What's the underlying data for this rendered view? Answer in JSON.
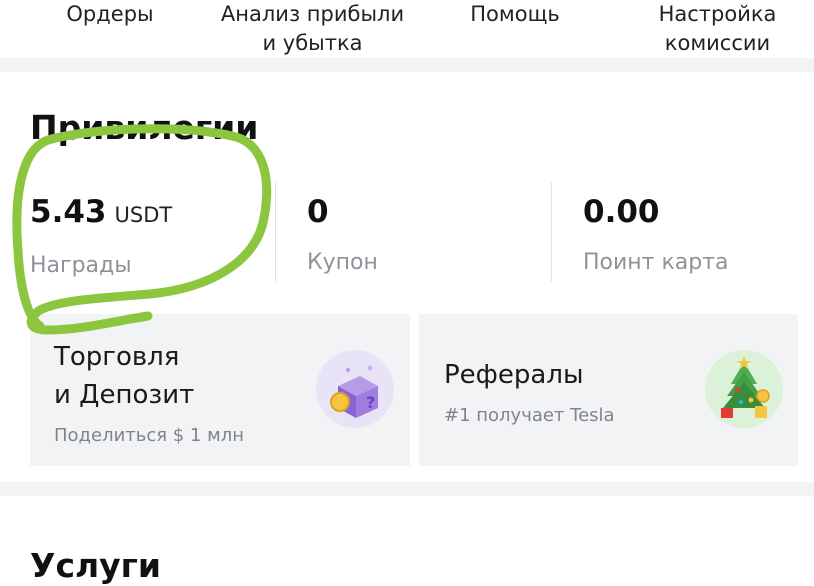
{
  "top_menu": {
    "orders": "Ордеры",
    "pnl_analysis": "Анализ прибыли\nи убытка",
    "help": "Помощь",
    "fee_settings": "Настройка\nкомиссии"
  },
  "privileges": {
    "title": "Привилегии",
    "rewards": {
      "value": "5.43",
      "unit": "USDT",
      "label": "Награды"
    },
    "coupon": {
      "value": "0",
      "label": "Купон"
    },
    "points_card": {
      "value": "0.00",
      "label": "Поинт карта"
    }
  },
  "cards": {
    "trade_deposit": {
      "title": "Торговля\nи Депозит",
      "subtitle": "Поделиться $ 1 млн"
    },
    "referrals": {
      "title": "Рефералы",
      "subtitle": "#1 получает Tesla"
    }
  },
  "services": {
    "title": "Услуги"
  },
  "colors": {
    "annotation_green": "#8cc63f",
    "card_bg": "#f2f3f5",
    "muted_text": "#8f9399"
  },
  "icons": {
    "trade_deposit": "mystery-gift-box-icon",
    "referrals": "christmas-tree-gifts-icon"
  }
}
